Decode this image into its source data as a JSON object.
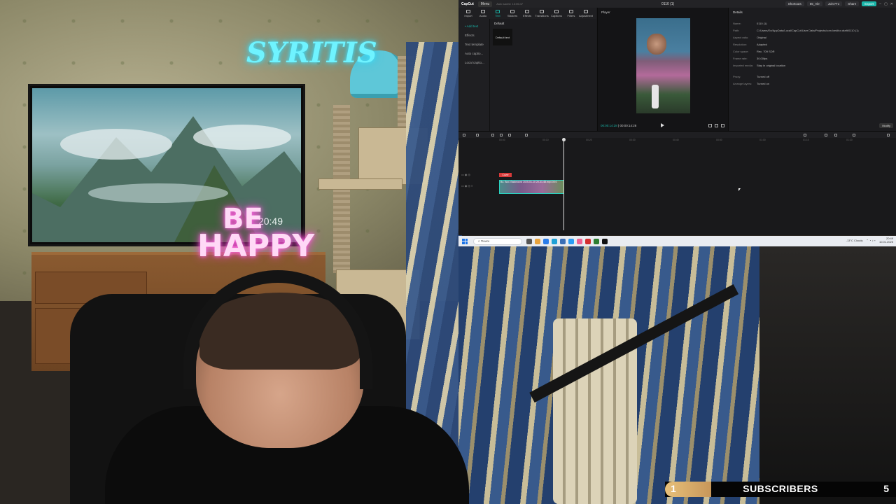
{
  "scene": {
    "neon_top": "SYRITIS",
    "neon_be": "BE",
    "neon_happy": "HAPPY",
    "tv_clock": "20:49"
  },
  "capcut": {
    "app_name": "CapCut",
    "menu_label": "Menu",
    "saved_status": "Auto saved: 13:06:47",
    "project_title": "0110 (1)",
    "shortcuts_label": "Shortcuts",
    "user_label": "65_Ale",
    "join_pro_label": "Join Pro",
    "share_label": "Share",
    "export_label": "Export",
    "toolbar": [
      "Import",
      "Audio",
      "Text",
      "Stickers",
      "Effects",
      "Transitions",
      "Captions",
      "Filters",
      "Adjustment"
    ],
    "active_tool": "Text",
    "left_nav": [
      "• Add text",
      "Effects",
      "Text template",
      "Auto captio...",
      "Local captio..."
    ],
    "asset_tab": "Default",
    "asset_card": "Default text",
    "player_label": "Player",
    "time_current": "00:00:14:28",
    "time_total": "00:00:14:28",
    "details_title": "Details",
    "details": [
      {
        "key": "Name:",
        "value": "0110 (1)"
      },
      {
        "key": "Path:",
        "value": "C:/Users/Ее/AppData/Local/CapCut/User Data/Projects/com.lveditor.draft/0110 (1)"
      },
      {
        "key": "Aspect ratio:",
        "value": "Original"
      },
      {
        "key": "Resolution:",
        "value": "Adapted"
      },
      {
        "key": "Color space:",
        "value": "Rec. 709 SDR"
      },
      {
        "key": "Frame rate:",
        "value": "30.00fps"
      },
      {
        "key": "Imported media:",
        "value": "Stay in original location"
      },
      {
        "key": "Proxy:",
        "value": "Turned off"
      },
      {
        "key": "Arrange layers:",
        "value": "Turned on"
      }
    ],
    "modify_label": "Modify",
    "ruler": [
      "00:00",
      "00:10",
      "00:20",
      "00:30",
      "00:40",
      "00:50",
      "01:00",
      "01:10",
      "01:20"
    ],
    "cover_label": "Cover",
    "clip_label": "Bo. Bod. Backround 2025-01-10 20-31-48.mp4  00:0"
  },
  "taskbar": {
    "search_placeholder": "Поиск",
    "weather": "-13°C Cloudy",
    "clock_time": "20:49",
    "clock_date": "10.01.2025"
  },
  "subscribers": {
    "label": "SUBSCRIBERS",
    "current": "1",
    "goal": "5",
    "progress_fraction": 0.2
  }
}
